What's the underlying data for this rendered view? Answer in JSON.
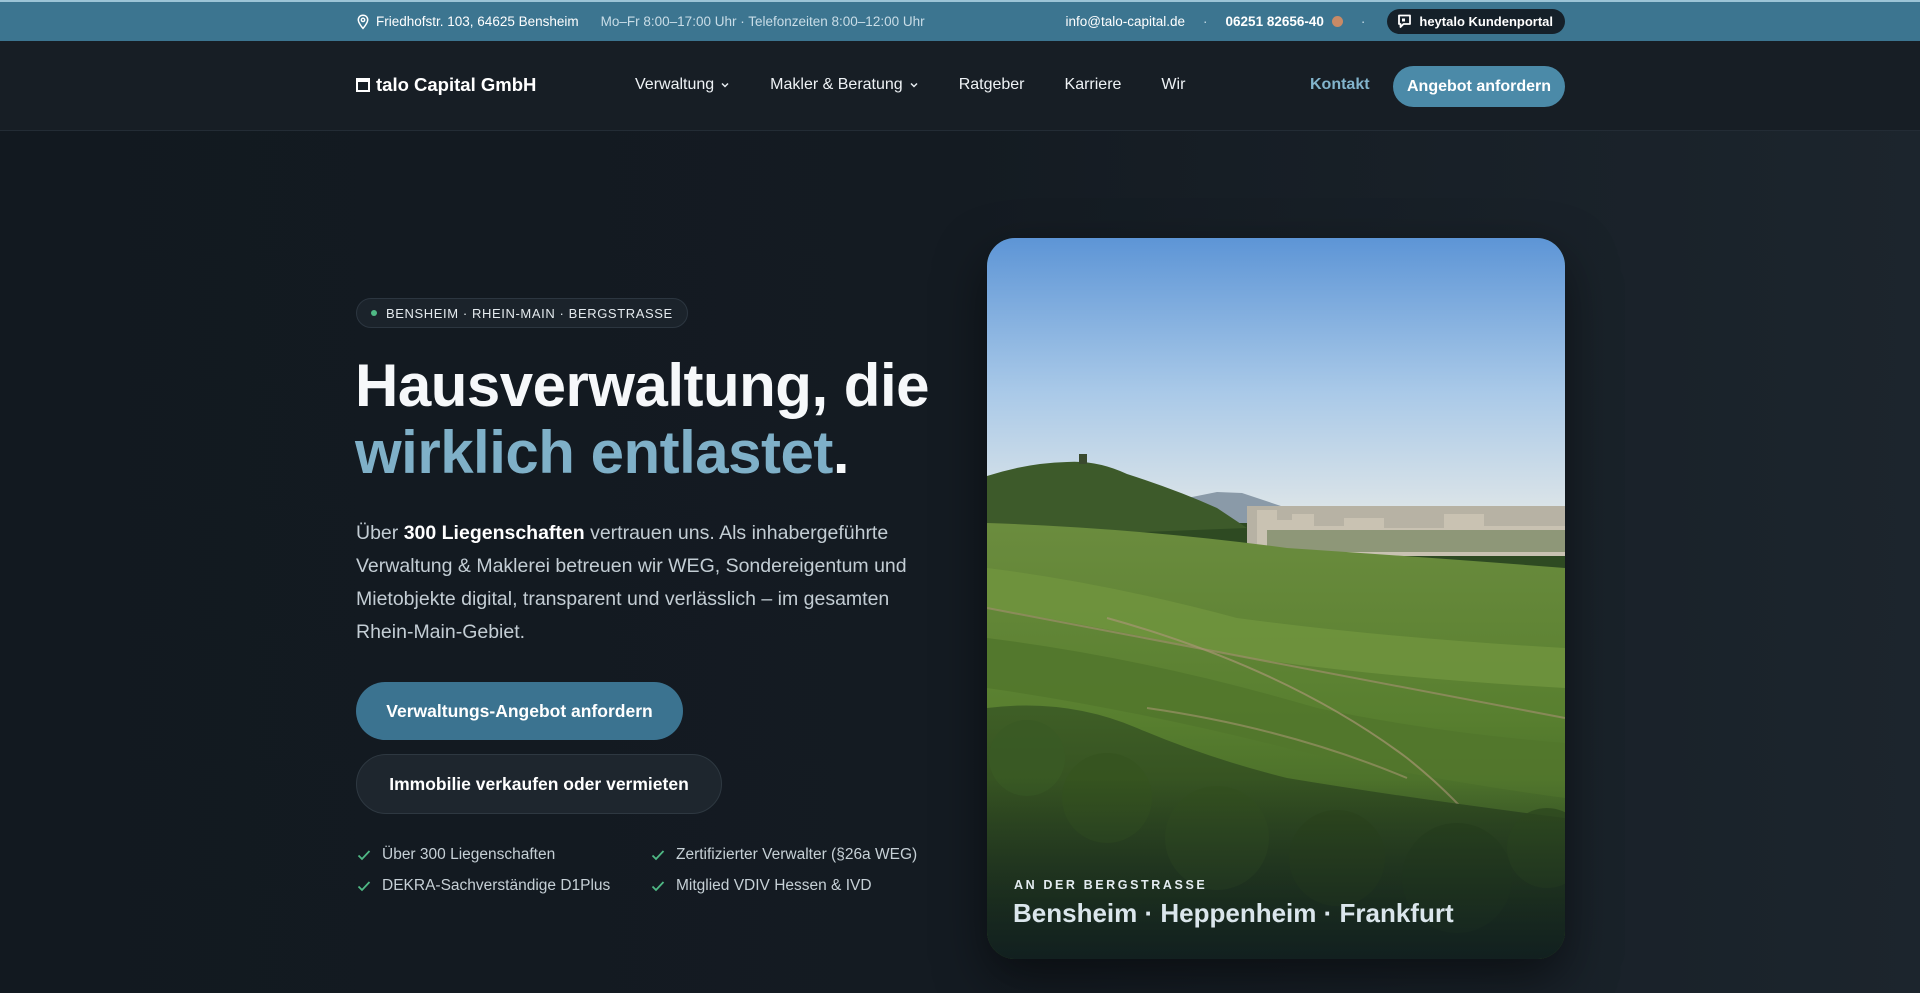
{
  "topbar": {
    "address": "Friedhofstr. 103, 64625 Bensheim",
    "hours": "Mo–Fr 8:00–17:00 Uhr · Telefonzeiten 8:00–12:00 Uhr",
    "email": "info@talo-capital.de",
    "separator": "·",
    "phone": "06251 82656-40",
    "portal_label": "heytalo Kundenportal",
    "icons": {
      "address": "map-pin-icon",
      "portal": "chat-icon"
    },
    "status_color": "#c88a66"
  },
  "nav": {
    "logo_text": "talo Capital GmbH",
    "items": [
      {
        "label": "Verwaltung",
        "has_dropdown": true
      },
      {
        "label": "Makler & Beratung",
        "has_dropdown": true
      },
      {
        "label": "Ratgeber",
        "has_dropdown": false
      },
      {
        "label": "Karriere",
        "has_dropdown": false
      },
      {
        "label": "Wir",
        "has_dropdown": false
      }
    ],
    "contact_label": "Kontakt",
    "cta_label": "Angebot anfordern"
  },
  "hero": {
    "badge": "BENSHEIM · RHEIN-MAIN · BERGSTRASSE",
    "headline_line1": "Hausverwaltung, die",
    "headline_accent": "wirklich entlastet",
    "headline_end": ".",
    "lead_prefix": "Über ",
    "lead_strong": "300 Liegenschaften",
    "lead_suffix": " vertrauen uns. Als inhabergeführte Verwaltung & Maklerei betreuen wir WEG, Sondereigentum und Mietobjekte digital, transparent und verlässlich – im gesamten Rhein-Main-Gebiet.",
    "primary_button": "Verwaltungs-Angebot anfordern",
    "secondary_button": "Immobilie verkaufen oder vermieten",
    "checks": [
      "Über 300 Liegenschaften",
      "Zertifizierter Verwalter (§26a WEG)",
      "DEKRA-Sachverständige D1Plus",
      "Mitglied VDIV Hessen & IVD"
    ]
  },
  "photo": {
    "kicker": "AN DER BERGSTRASSE",
    "title": "Bensheim · Heppenheim · Frankfurt"
  },
  "colors": {
    "accent": "#7fb0c8",
    "primary_button": "#3b7390",
    "topbar": "#3c7590",
    "check_green": "#4fb985"
  }
}
